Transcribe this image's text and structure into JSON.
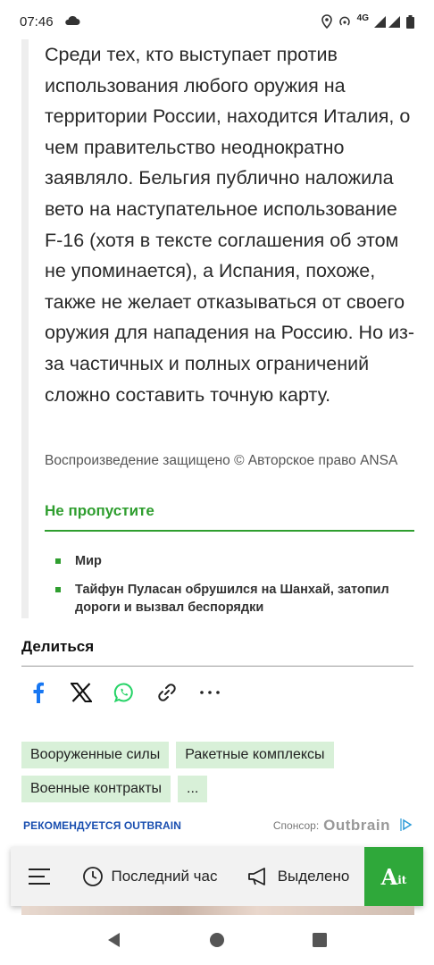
{
  "status_bar": {
    "time": "07:46",
    "network": "4G"
  },
  "article": {
    "paragraph": "Среди тех, кто выступает против использования любого оружия на территории России, находится Италия, о чем правительство неоднократно заявляло. Бельгия публично наложила вето на наступательное использование F-16 (хотя в тексте соглашения об этом не упоминается), а Испания, похоже, также не желает отказываться от своего оружия для нападения на Россию. Но из-за частичных и полных ограничений сложно составить точную карту.",
    "copyright": "Воспроизведение защищено © Авторское право ANSA"
  },
  "dont_miss": {
    "title": "Не пропустите",
    "items": [
      "Мир",
      "Тайфун Пуласан обрушился на Шанхай, затопил дороги и вызвал беспорядки"
    ]
  },
  "share": {
    "title": "Делиться",
    "icons": [
      "facebook-icon",
      "x-icon",
      "whatsapp-icon",
      "link-icon",
      "more-icon"
    ]
  },
  "tags": [
    "Вооруженные силы",
    "Ракетные комплексы",
    "Военные контракты",
    "..."
  ],
  "outbrain": {
    "recommended_prefix": "РЕКОМЕНДУЕТСЯ",
    "recommended_brand": "OUTBRAIN",
    "sponsor_label": "Спонсор:",
    "logo_text": "Outbrain"
  },
  "bottom_nav": {
    "latest_label": "Последний час",
    "highlights_label": "Выделено",
    "brand": "A",
    "brand_suffix": "it"
  },
  "colors": {
    "accent_green": "#2f9e2f",
    "tag_bg": "#d8f0d8",
    "outbrain_blue": "#1a4fb0",
    "whatsapp": "#25d366",
    "facebook": "#1877f2"
  }
}
